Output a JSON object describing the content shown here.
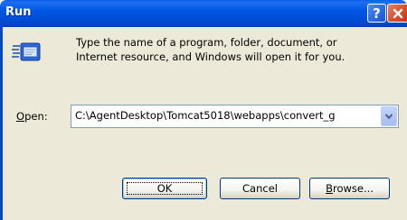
{
  "window": {
    "title": "Run",
    "help_glyph": "?",
    "close_glyph": "✕"
  },
  "description": {
    "line1": "Type the name of a program, folder, document, or",
    "line2": "Internet resource, and Windows will open it for you."
  },
  "open": {
    "label_accel": "O",
    "label_rest": "pen:",
    "value": "C:\\AgentDesktop\\Tomcat5018\\webapps\\convert_g"
  },
  "buttons": {
    "ok": "OK",
    "cancel": "Cancel",
    "browse_accel": "B",
    "browse_rest": "rowse..."
  },
  "icons": {
    "run": "run-icon",
    "help": "help-icon",
    "close": "close-icon",
    "dropdown": "chevron-down-icon"
  },
  "colors": {
    "titlebar": "#0055e5",
    "dialog_bg": "#ece9d8",
    "close": "#d8502a",
    "combo_border": "#7f9db9"
  }
}
